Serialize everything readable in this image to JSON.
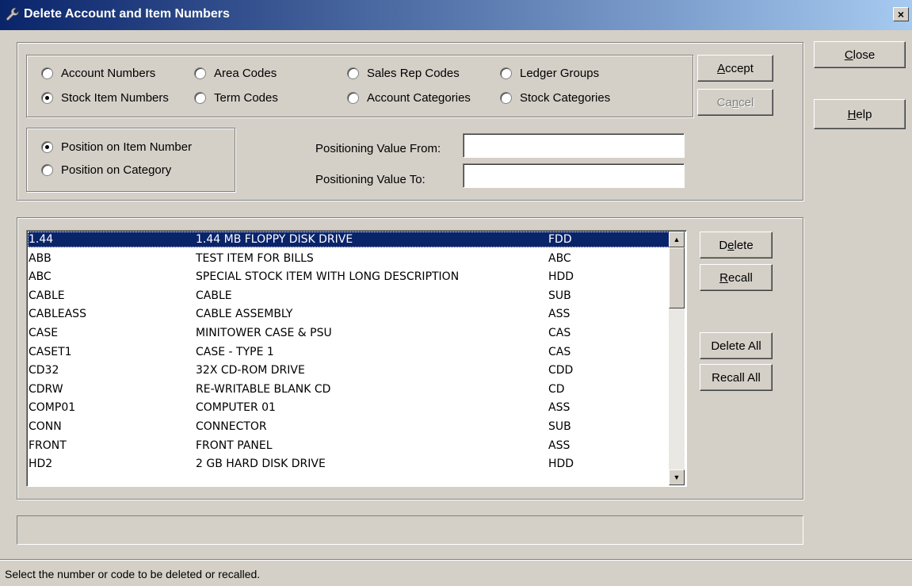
{
  "window": {
    "title": "Delete Account and Item Numbers",
    "close_glyph": "×"
  },
  "type_options": [
    {
      "label": "Account Numbers",
      "selected": false
    },
    {
      "label": "Area Codes",
      "selected": false
    },
    {
      "label": "Sales Rep Codes",
      "selected": false
    },
    {
      "label": "Ledger Groups",
      "selected": false
    },
    {
      "label": "Stock Item Numbers",
      "selected": true
    },
    {
      "label": "Term Codes",
      "selected": false
    },
    {
      "label": "Account Categories",
      "selected": false
    },
    {
      "label": "Stock Categories",
      "selected": false
    }
  ],
  "position_options": [
    {
      "label": "Position on Item Number",
      "selected": true
    },
    {
      "label": "Position on Category",
      "selected": false
    }
  ],
  "positioning": {
    "from_label": "Positioning Value From:",
    "from_value": "",
    "to_label": "Positioning Value To:",
    "to_value": ""
  },
  "buttons": {
    "accept": {
      "pre": "",
      "key": "A",
      "post": "ccept",
      "enabled": true
    },
    "cancel": {
      "pre": "Ca",
      "key": "n",
      "post": "cel",
      "enabled": false
    },
    "close": {
      "pre": "",
      "key": "C",
      "post": "lose"
    },
    "help": {
      "pre": "",
      "key": "H",
      "post": "elp"
    },
    "delete": {
      "pre": "D",
      "key": "e",
      "post": "lete"
    },
    "recall": {
      "pre": "",
      "key": "R",
      "post": "ecall"
    },
    "delete_all": "Delete All",
    "recall_all": "Recall All"
  },
  "items": [
    {
      "code": "1.44",
      "description": "1.44 MB FLOPPY DISK DRIVE",
      "category": "FDD",
      "selected": true
    },
    {
      "code": "ABB",
      "description": "TEST ITEM FOR BILLS",
      "category": "ABC"
    },
    {
      "code": "ABC",
      "description": "SPECIAL STOCK ITEM WITH LONG DESCRIPTION",
      "category": "HDD"
    },
    {
      "code": "CABLE",
      "description": "CABLE",
      "category": "SUB"
    },
    {
      "code": "CABLEASS",
      "description": "CABLE ASSEMBLY",
      "category": "ASS"
    },
    {
      "code": "CASE",
      "description": "MINITOWER CASE & PSU",
      "category": "CAS"
    },
    {
      "code": "CASET1",
      "description": "CASE - TYPE 1",
      "category": "CAS"
    },
    {
      "code": "CD32",
      "description": "32X CD-ROM DRIVE",
      "category": "CDD"
    },
    {
      "code": "CDRW",
      "description": "RE-WRITABLE BLANK CD",
      "category": "CD"
    },
    {
      "code": "COMP01",
      "description": "COMPUTER 01",
      "category": "ASS"
    },
    {
      "code": "CONN",
      "description": "CONNECTOR",
      "category": "SUB"
    },
    {
      "code": "FRONT",
      "description": "FRONT PANEL",
      "category": "ASS"
    },
    {
      "code": "HD2",
      "description": "2 GB HARD DISK DRIVE",
      "category": "HDD"
    }
  ],
  "scrollbar": {
    "up_glyph": "▲",
    "down_glyph": "▼"
  },
  "status_bar": {
    "text": "Select the number or code to be deleted or recalled."
  }
}
